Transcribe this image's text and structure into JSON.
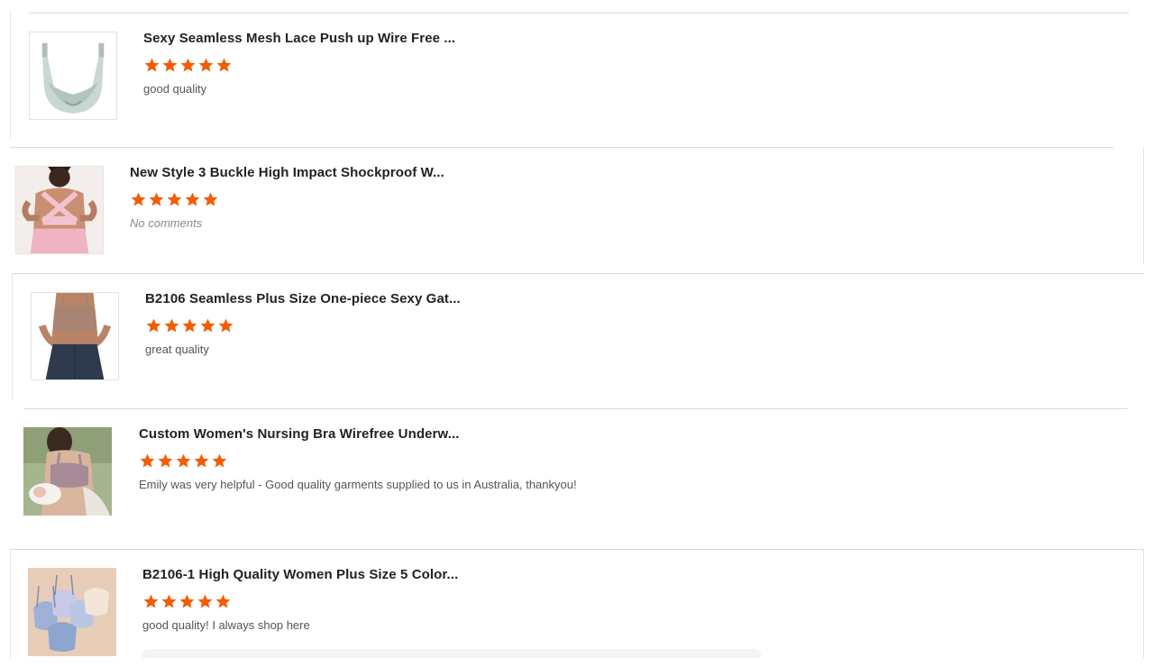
{
  "reviews": [
    {
      "title": "Sexy Seamless Mesh Lace Push up Wire Free ...",
      "rating": 5,
      "comment": "good quality",
      "thumbnail": "light-sage-seamless-bra"
    },
    {
      "title": "New Style 3 Buckle High Impact Shockproof W...",
      "rating": 5,
      "comment": "No comments",
      "thumbnail": "pink-sports-bra-back-view"
    },
    {
      "title": "B2106 Seamless Plus Size One-piece Sexy Gat...",
      "rating": 5,
      "comment": "great quality",
      "thumbnail": "taupe-bra-model"
    },
    {
      "title": "Custom Women's Nursing Bra Wirefree Underw...",
      "rating": 5,
      "comment": "Emily was very helpful - Good quality garments supplied to us in Australia, thankyou!",
      "thumbnail": "nursing-bra-mother-baby"
    },
    {
      "title": "B2106-1 High Quality Women Plus Size 5 Color...",
      "rating": 5,
      "comment": "good quality! I always shop here",
      "thumbnail": "five-color-bra-set"
    }
  ],
  "colors": {
    "star": "#f25c05",
    "title": "#222222",
    "comment": "#555555",
    "divider": "#d9d9d9"
  },
  "icons": {
    "star": "star-icon"
  }
}
